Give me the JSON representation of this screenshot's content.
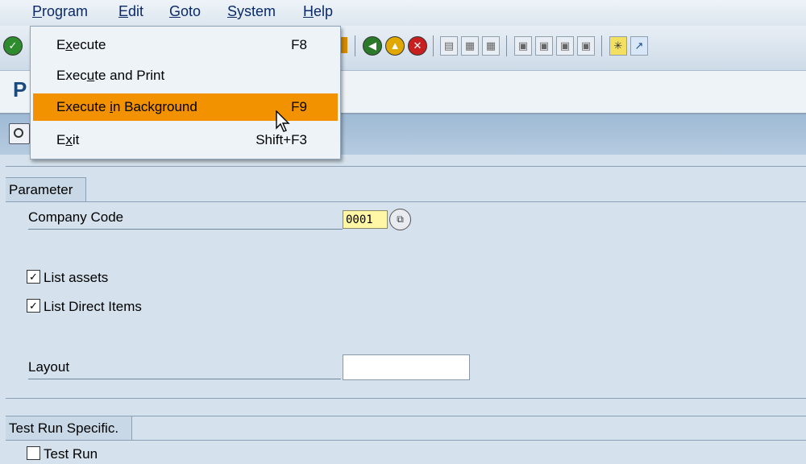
{
  "menubar": {
    "items": [
      {
        "label": "Program",
        "underline": "P",
        "rest": "rogram"
      },
      {
        "label": "Edit",
        "underline": "E",
        "rest": "dit"
      },
      {
        "label": "Goto",
        "underline": "G",
        "rest": "oto"
      },
      {
        "label": "System",
        "underline": "S",
        "rest": "ystem"
      },
      {
        "label": "Help",
        "underline": "H",
        "rest": "elp"
      }
    ]
  },
  "title": {
    "letter": "P"
  },
  "dropdown": {
    "items": [
      {
        "pre": "E",
        "u": "x",
        "post": "ecute",
        "shortcut": "F8"
      },
      {
        "pre": "Exec",
        "u": "u",
        "post": "te and Print",
        "shortcut": ""
      },
      {
        "pre": "Execute ",
        "u": "i",
        "post": "n Background",
        "shortcut": "F9"
      },
      {
        "pre": "E",
        "u": "x",
        "post": "it",
        "shortcut": "Shift+F3"
      }
    ]
  },
  "parameter": {
    "group_title": "Parameter",
    "company_code_label": "Company Code",
    "company_code_value": "0001",
    "list_assets_label": "List assets",
    "list_assets_checked": true,
    "list_direct_label": "List Direct Items",
    "list_direct_checked": true,
    "layout_label": "Layout",
    "layout_value": ""
  },
  "test_run": {
    "group_title": "Test Run Specific.",
    "test_run_label": "Test Run",
    "test_run_checked": false
  },
  "colors": {
    "highlight": "#f39200",
    "background": "#d5e1ec",
    "title": "#1c4a7e"
  }
}
